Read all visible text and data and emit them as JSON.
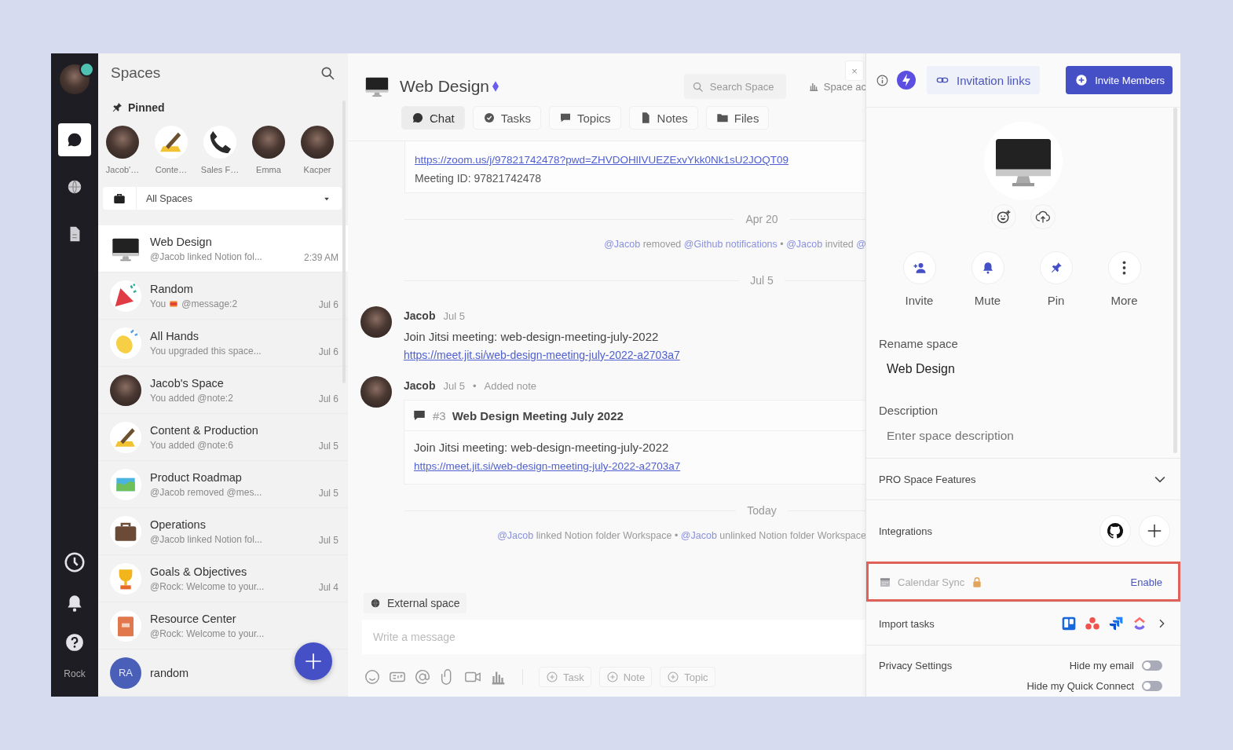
{
  "rail": {
    "items": [
      {
        "selected": true
      },
      {
        "selected": false
      },
      {
        "selected": false
      }
    ],
    "label": "Rock"
  },
  "sidebar": {
    "title": "Spaces",
    "pinned_label": "Pinned",
    "pinned": [
      {
        "label": "Jacob'…",
        "kind": "photo"
      },
      {
        "label": "Conte…",
        "kind": "pen"
      },
      {
        "label": "Sales F…",
        "kind": "phone"
      },
      {
        "label": "Emma",
        "kind": "photo"
      },
      {
        "label": "Kacper",
        "kind": "photo"
      }
    ],
    "filter": "All Spaces",
    "spaces": [
      {
        "name": "Web Design",
        "preview": "@Jacob linked Notion fol...",
        "time": "2:39 AM",
        "kind": "monitor",
        "selected": true
      },
      {
        "name": "Random",
        "preview_prefix": "You",
        "preview": "@message:2",
        "time": "Jul 6",
        "kind": "party",
        "selected": false
      },
      {
        "name": "All Hands",
        "preview": "You upgraded this space...",
        "time": "Jul 6",
        "kind": "hands",
        "selected": false
      },
      {
        "name": "Jacob's Space",
        "preview": "You added @note:2",
        "time": "Jul 6",
        "kind": "photo",
        "selected": false
      },
      {
        "name": "Content & Production",
        "preview": "You added @note:6",
        "time": "Jul 5",
        "kind": "pen",
        "selected": false
      },
      {
        "name": "Product Roadmap",
        "preview": "@Jacob removed @mes...",
        "time": "Jul 5",
        "kind": "map",
        "selected": false
      },
      {
        "name": "Operations",
        "preview": "@Jacob linked Notion fol...",
        "time": "Jul 5",
        "kind": "briefcase",
        "selected": false
      },
      {
        "name": "Goals & Objectives",
        "preview": "@Rock: Welcome to your...",
        "time": "Jul 4",
        "kind": "trophy",
        "selected": false
      },
      {
        "name": "Resource Center",
        "preview": "@Rock: Welcome to your...",
        "kind": "book",
        "selected": false
      },
      {
        "name": "random",
        "kind": "initials",
        "initials": "RA",
        "selected": false
      }
    ]
  },
  "chat": {
    "title": "Web Design",
    "search_placeholder": "Search Space",
    "activity_button": "Space ac",
    "close": "×",
    "tabs": [
      {
        "label": "Chat",
        "selected": true
      },
      {
        "label": "Tasks",
        "selected": false
      },
      {
        "label": "Topics",
        "selected": false
      },
      {
        "label": "Notes",
        "selected": false
      },
      {
        "label": "Files",
        "selected": false
      }
    ],
    "messages": [
      {
        "kind": "card_tail",
        "link": "https://zoom.us/j/97821742478?pwd=ZHVDOHlIVUEZExvYkk0Nk1sU2JOQT09",
        "text": "Meeting ID: 97821742478"
      },
      {
        "kind": "date",
        "text": "Apr 20"
      },
      {
        "kind": "activity",
        "parts": [
          {
            "text": "@Jacob",
            "mention": true
          },
          {
            "text": " removed ",
            "mention": false
          },
          {
            "text": "@Github notifications",
            "mention": true
          },
          {
            "text": "  •  ",
            "mention": false
          },
          {
            "text": "@Jacob",
            "mention": true
          },
          {
            "text": " invited ",
            "mention": false
          },
          {
            "text": "@",
            "mention": true
          }
        ]
      },
      {
        "kind": "date",
        "text": "Jul 5"
      },
      {
        "kind": "message",
        "author": "Jacob",
        "time": "Jul 5",
        "text": "Join Jitsi meeting: web-design-meeting-july-2022",
        "link": "https://meet.jit.si/web-design-meeting-july-2022-a2703a7"
      },
      {
        "kind": "note",
        "author": "Jacob",
        "time": "Jul 5",
        "separator": "•",
        "action": "Added note",
        "number": "#3",
        "title": "Web Design Meeting July 2022",
        "text": "Join Jitsi meeting: web-design-meeting-july-2022",
        "link": "https://meet.jit.si/web-design-meeting-july-2022-a2703a7"
      },
      {
        "kind": "date",
        "text": "Today"
      },
      {
        "kind": "activity",
        "parts": [
          {
            "text": "@Jacob",
            "mention": true
          },
          {
            "text": " linked Notion folder Workspace  •  ",
            "mention": false
          },
          {
            "text": "@Jacob",
            "mention": true
          },
          {
            "text": " unlinked Notion folder Workspace",
            "mention": false
          }
        ]
      }
    ],
    "external_label": "External space",
    "composer_placeholder": "Write a message",
    "quick_actions": [
      "Task",
      "Note",
      "Topic"
    ]
  },
  "settings": {
    "invitation_links": "Invitation links",
    "invite_members": "Invite Members",
    "actions": [
      {
        "label": "Invite"
      },
      {
        "label": "Mute"
      },
      {
        "label": "Pin"
      },
      {
        "label": "More"
      }
    ],
    "rename_label": "Rename space",
    "name_value": "Web Design",
    "description_label": "Description",
    "description_placeholder": "Enter space description",
    "pro_features": {
      "label": "PRO Space Features",
      "expanded": false
    },
    "integrations": {
      "label": "Integrations"
    },
    "calendar_sync": {
      "label": "Calendar Sync",
      "locked": true,
      "action": "Enable",
      "highlighted": true
    },
    "import_tasks": {
      "label": "Import tasks"
    },
    "privacy": {
      "label": "Privacy Settings",
      "toggles": [
        {
          "label": "Hide my email",
          "on": false
        },
        {
          "label": "Hide my Quick Connect",
          "on": false
        }
      ]
    }
  }
}
